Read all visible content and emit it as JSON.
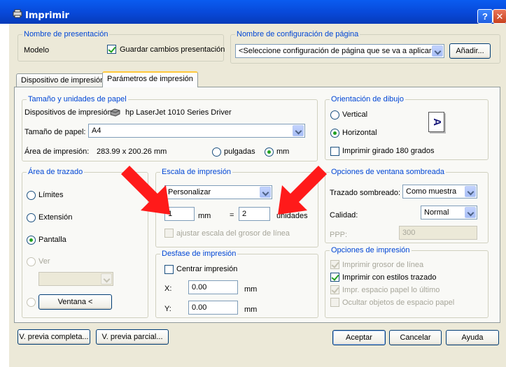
{
  "window": {
    "title": "Imprimir",
    "help_label": "?",
    "close_label": "✕"
  },
  "presentation": {
    "legend": "Nombre de presentación",
    "name": "Modelo",
    "save_changes_label": "Guardar cambios presentación",
    "save_changes_checked": true
  },
  "page_setup": {
    "legend": "Nombre de configuración de página",
    "selected": "<Seleccione configuración de página que se va a aplicar>",
    "add_label": "Añadir..."
  },
  "tabs": [
    {
      "label": "Dispositivo de impresión",
      "active": false
    },
    {
      "label": "Parámetros de impresión",
      "active": true
    }
  ],
  "paper": {
    "legend": "Tamaño y unidades de papel",
    "device_label": "Dispositivos de impresión:",
    "device_name": "hp LaserJet 1010 Series Driver",
    "size_label": "Tamaño de papel:",
    "size_value": "A4",
    "area_label": "Área de impresión:",
    "area_value": "283.99 x 200.26 mm",
    "inches_label": "pulgadas",
    "mm_label": "mm",
    "selected_unit": "mm"
  },
  "orientation": {
    "legend": "Orientación de dibujo",
    "vertical_label": "Vertical",
    "horizontal_label": "Horizontal",
    "selected": "Horizontal",
    "rotate_label": "Imprimir girado 180 grados",
    "rotate_checked": false,
    "preview_glyph": "A"
  },
  "plot_area": {
    "legend": "Área de trazado",
    "limits_label": "Límites",
    "extents_label": "Extensión",
    "display_label": "Pantalla",
    "view_label": "Ver",
    "selected": "Pantalla",
    "window_button": "Ventana <"
  },
  "scale": {
    "legend": "Escala de impresión",
    "selected": "Personalizar",
    "mm_value": "1",
    "mm_label": "mm",
    "equals": "=",
    "units_value": "2",
    "units_label": "unidades",
    "lineweight_label": "ajustar escala del grosor de línea",
    "lineweight_checked": false
  },
  "offset": {
    "legend": "Desfase de impresión",
    "center_label": "Centrar impresión",
    "center_checked": false,
    "x_label": "X:",
    "x_value": "0.00",
    "x_unit": "mm",
    "y_label": "Y:",
    "y_value": "0.00",
    "y_unit": "mm"
  },
  "shaded": {
    "legend": "Opciones de ventana sombreada",
    "shade_label": "Trazado sombreado:",
    "shade_value": "Como muestra",
    "quality_label": "Calidad:",
    "quality_value": "Normal",
    "dpi_label": "PPP:",
    "dpi_value": "300"
  },
  "print_options": {
    "legend": "Opciones de impresión",
    "items": [
      {
        "label": "Imprimir grosor de línea",
        "checked": true,
        "enabled": false
      },
      {
        "label": "Imprimir con estilos trazado",
        "checked": true,
        "enabled": true
      },
      {
        "label": "Impr. espacio papel lo último",
        "checked": true,
        "enabled": false
      },
      {
        "label": "Ocultar objetos de espacio papel",
        "checked": false,
        "enabled": false
      }
    ]
  },
  "footer": {
    "full_preview": "V. previa completa...",
    "partial_preview": "V. previa parcial...",
    "accept": "Aceptar",
    "cancel": "Cancelar",
    "help": "Ayuda"
  },
  "colors": {
    "title_bar": "#0848d8",
    "legend_text": "#0046d5",
    "dialog_bg": "#ece9d8",
    "annotation_arrow": "#ff1a1a"
  }
}
